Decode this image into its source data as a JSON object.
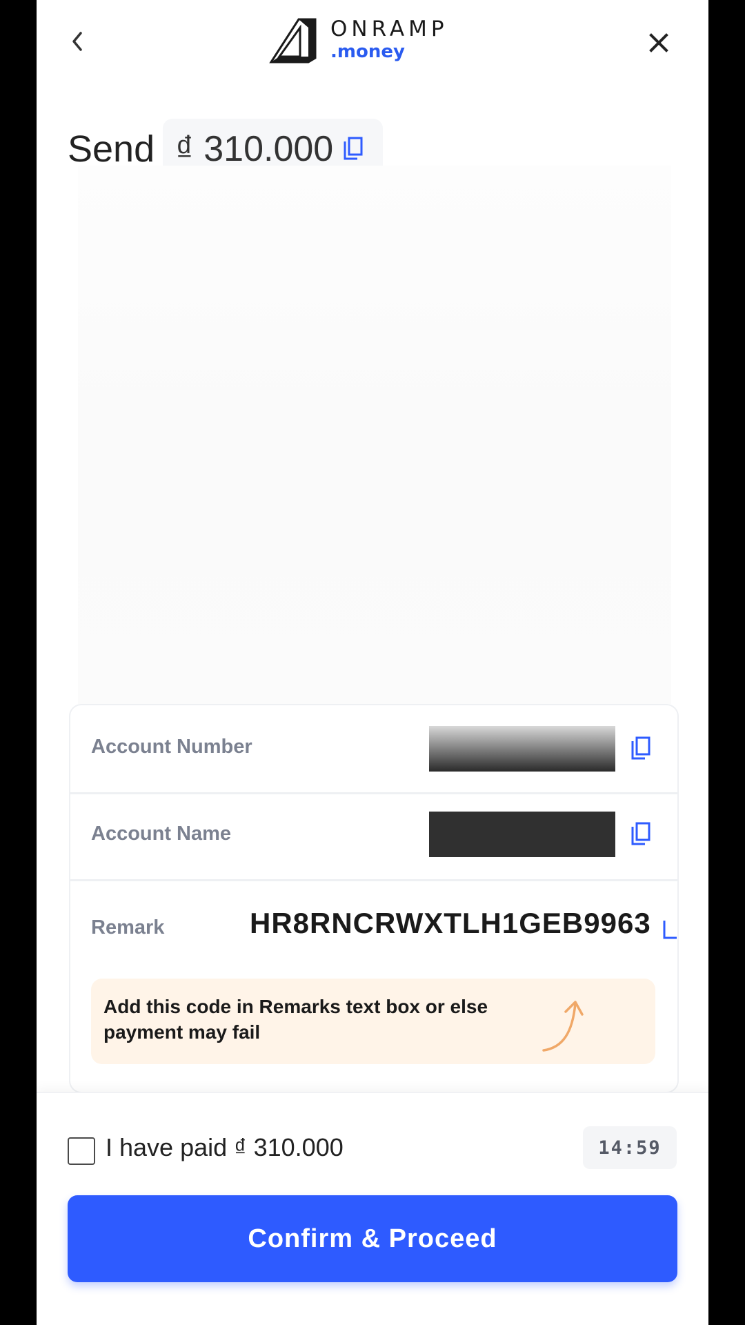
{
  "brand": {
    "name": "ONRAMP",
    "sub": ".money",
    "accent": "#2a5bf0"
  },
  "header": {
    "back_icon": "chevron-left-icon",
    "close_icon": "close-icon"
  },
  "send": {
    "label": "Send",
    "amount": "₫ 310.000"
  },
  "details": {
    "account_number_label": "Account Number",
    "account_name_label": "Account Name",
    "remark_label": "Remark",
    "remark_value": "HR8RNCRWXTLH1GEB9963",
    "warning": "Add this code in Remarks text box or else payment may fail"
  },
  "footer": {
    "paid_label": "I have paid ₫ 310.000",
    "timer": "14:59",
    "confirm_label": "Confirm & Proceed",
    "button_color": "#2e5bff"
  }
}
